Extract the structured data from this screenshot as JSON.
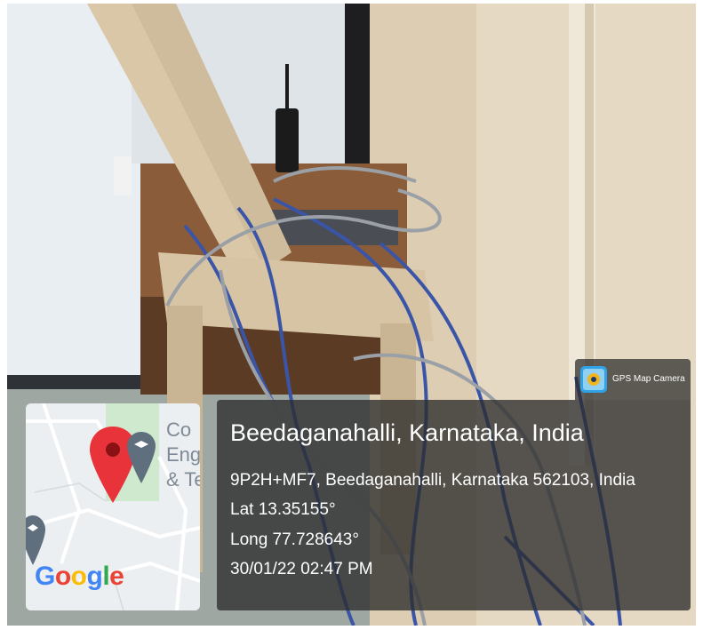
{
  "badge": {
    "label": "GPS Map Camera",
    "icon": "gps-map-camera-app-icon"
  },
  "location": {
    "place": "Beedaganahalli, Karnataka, India",
    "address": "9P2H+MF7, Beedaganahalli, Karnataka 562103, India",
    "lat": "Lat 13.35155°",
    "long": "Long 77.728643°",
    "datetime": "30/01/22 02:47 PM"
  },
  "map": {
    "label_partial": "Co\nEng\n& Te",
    "logo": "Google",
    "pin_icon": "map-pin-icon",
    "school_icon": "graduation-cap-icon"
  },
  "colors": {
    "panel": "#2d2d2d",
    "pin": "#e8333a",
    "google_blue": "#4285f4",
    "google_red": "#ea4335",
    "google_yellow": "#fbbc05",
    "google_green": "#34a853"
  }
}
